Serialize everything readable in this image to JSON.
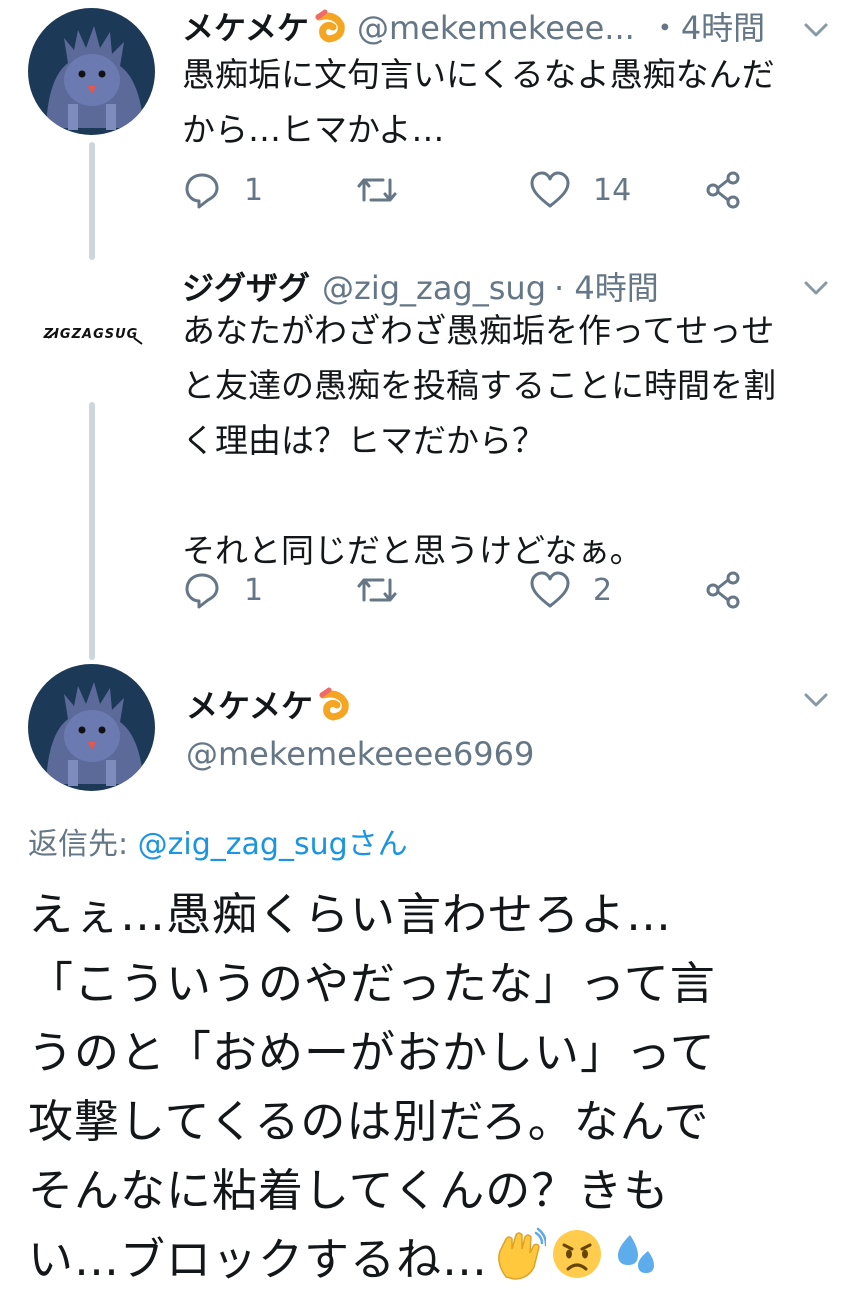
{
  "tweets": [
    {
      "name": "メケメケ",
      "handle": "@mekemekeee...",
      "time": "・4時間",
      "text": "愚痴垢に文句言いにくるなよ愚痴なんだ\nから…ヒマかよ…",
      "replies": "1",
      "likes": "14"
    },
    {
      "name": "ジグザグ",
      "handle": "@zig_zag_sug",
      "time": "· 4時間",
      "avatar_text": "ZIGZAGSUG",
      "text": "あなたがわざわざ愚痴垢を作ってせっせ\nと友達の愚痴を投稿することに時間を割\nく理由は？ヒマだから？\n\nそれと同じだと思うけどなぁ。",
      "replies": "1",
      "likes": "2"
    }
  ],
  "main": {
    "name": "メケメケ",
    "handle": "@mekemekeeee6969",
    "reply_label": "返信先:",
    "reply_mention": "@zig_zag_sugさん",
    "text": "えぇ…愚痴くらい言わせろよ…\n「こういうのやだったな」って言\nうのと「おめーがおかしい」って\n攻撃してくるのは別だろ。なんで\nそんなに粘着してくんの？きも\nい…ブロックするね…"
  },
  "icons": {
    "reply": "reply-icon",
    "retweet": "retweet-icon",
    "like": "heart-icon",
    "share": "share-icon",
    "caret": "chevron-down-icon",
    "name_emoji": "shrimp-tempura-emoji",
    "end_emojis": [
      "waving-hand-emoji",
      "worried-face-emoji",
      "sweat-droplets-emoji"
    ]
  },
  "colors": {
    "text": "#14171a",
    "secondary": "#657786",
    "link": "#1b95e0",
    "thread_line": "#ccd6dd"
  }
}
